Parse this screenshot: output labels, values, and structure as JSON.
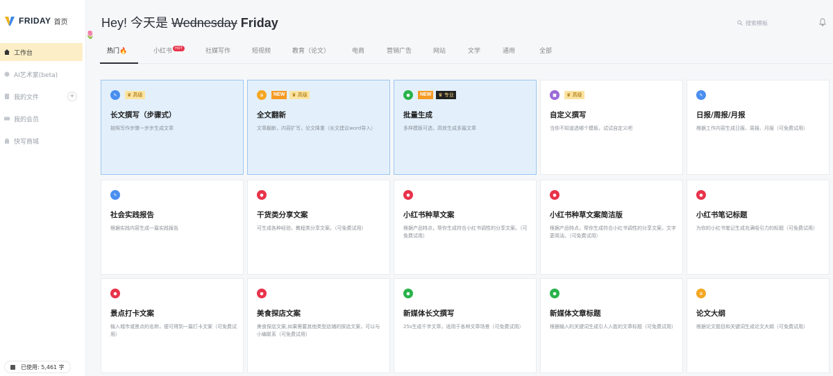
{
  "sidebar": {
    "brand": "FRIDAY",
    "home": "首页",
    "items": [
      {
        "label": "工作台",
        "icon": "home-icon"
      },
      {
        "label": "AI艺术家(beta)",
        "icon": "palette-icon"
      },
      {
        "label": "我的文件",
        "icon": "file-icon",
        "action": "+"
      },
      {
        "label": "我的会员",
        "icon": "card-icon"
      },
      {
        "label": "快写商城",
        "icon": "shop-icon"
      }
    ],
    "usage": "已使用: 5,461 字"
  },
  "header": {
    "greeting_prefix": "Hey! 今天是",
    "greeting_struck": "Wednesday",
    "greeting_day": "Friday",
    "search_placeholder": "搜索模板"
  },
  "tabs": [
    {
      "label": "热门🔥"
    },
    {
      "label": "小红书",
      "badge": "HOT"
    },
    {
      "label": "社媒写作"
    },
    {
      "label": "短视频"
    },
    {
      "label": "教育（论文）"
    },
    {
      "label": "电商"
    },
    {
      "label": "营销广告"
    },
    {
      "label": "网站"
    },
    {
      "label": "文学"
    },
    {
      "label": "通用"
    },
    {
      "label": "全部"
    }
  ],
  "badges": {
    "new": "NEW",
    "adv": "♛ 高级",
    "pro": "♛ 专业"
  },
  "colors": {
    "accent_yellow": "#fcefc8",
    "highlight_bg": "#e3f0fc",
    "highlight_border": "#9cc6ee",
    "xhs_red": "#e8334b",
    "wechat_green": "#29b34a",
    "edit_blue": "#4a8ff0"
  },
  "cards": [
    {
      "title": "长文撰写（步骤式）",
      "desc": "按照写作步骤一步步生成文章",
      "icon": "edit-icon"
    },
    {
      "title": "全文翻新",
      "desc": "文章翻新，内容扩写，论文降重（长文建议word导入）",
      "icon": "doc-icon"
    },
    {
      "title": "批量生成",
      "desc": "多样模板可选，高效生成多篇文章",
      "icon": "wechat-icon"
    },
    {
      "title": "自定义撰写",
      "desc": "当你不知道选哪个模板，试试自定义吧",
      "icon": "lock-icon"
    },
    {
      "title": "日报/周报/月报",
      "desc": "根据工作内容生成日报、周报、月报（可免费试用）",
      "icon": "edit-icon"
    },
    {
      "title": "社会实践报告",
      "desc": "根据实践内容生成一篇实践报告",
      "icon": "edit-icon"
    },
    {
      "title": "干货类分享文案",
      "desc": "可生成各种经验、教程类分享文案。（可免费试用）",
      "icon": "xiaohongshu-icon"
    },
    {
      "title": "小红书种草文案",
      "desc": "根据产品特点，帮你生成符合小红书调性的分享文案。（可免费试用）",
      "icon": "xiaohongshu-icon"
    },
    {
      "title": "小红书种草文案简洁版",
      "desc": "根据产品特点，帮你生成符合小红书调性的分享文案，文字更简洁。（可免费试用）",
      "icon": "xiaohongshu-icon"
    },
    {
      "title": "小红书笔记标题",
      "desc": "为你的小红书笔记生成充满吸引力的标题（可免费试用）",
      "icon": "xiaohongshu-icon"
    },
    {
      "title": "景点打卡文案",
      "desc": "输入城市或景点的名称，便可得到一篇打卡文案（可免费试用）",
      "icon": "xiaohongshu-icon"
    },
    {
      "title": "美食探店文案",
      "desc": "美食探店文案,如果需要其他类型店铺的探店文案，可以与小编联系（可免费试用）",
      "icon": "xiaohongshu-icon"
    },
    {
      "title": "新媒体长文撰写",
      "desc": "25s生成千字文章，适用于各种文章场景（可免费试用）",
      "icon": "wechat-icon"
    },
    {
      "title": "新媒体文章标题",
      "desc": "根据输入的关键词生成引人入胜的文章标题（可免费试用）",
      "icon": "wechat-icon"
    },
    {
      "title": "论文大纲",
      "desc": "根据论文题目和关键词生成论文大纲（可免费试用）",
      "icon": "doc-icon"
    }
  ]
}
